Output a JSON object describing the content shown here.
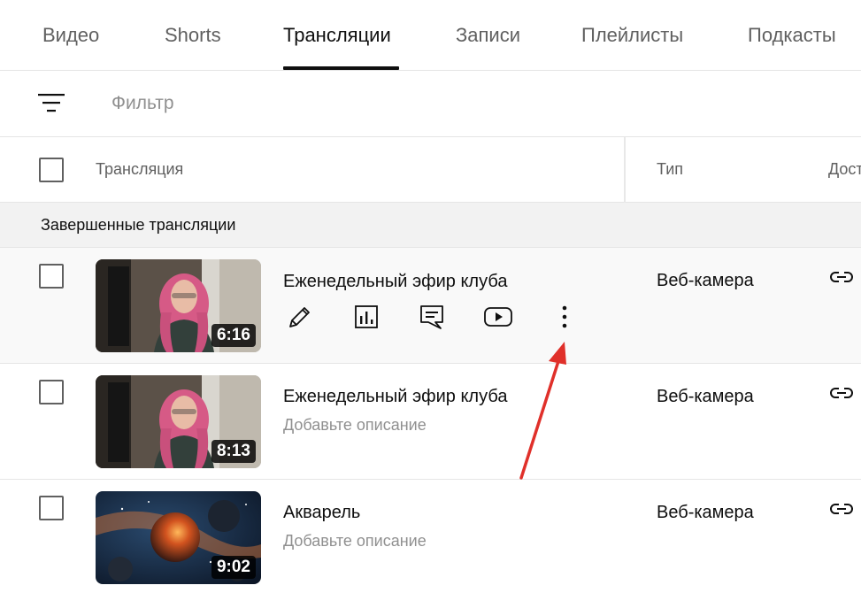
{
  "tabs": [
    {
      "label": "Видео"
    },
    {
      "label": "Shorts"
    },
    {
      "label": "Трансляции",
      "active": true
    },
    {
      "label": "Записи"
    },
    {
      "label": "Плейлисты"
    },
    {
      "label": "Подкасты"
    }
  ],
  "filter": {
    "placeholder": "Фильтр",
    "icon": "filter-icon"
  },
  "table": {
    "headers": {
      "broadcast": "Трансляция",
      "type": "Тип",
      "access": "Дост"
    },
    "section_title": "Завершенные трансляции",
    "rows": [
      {
        "title": "Еженедельный эфир клуба",
        "description": "",
        "duration": "6:16",
        "type": "Веб-камера",
        "hovered": true
      },
      {
        "title": "Еженедельный эфир клуба",
        "description": "Добавьте описание",
        "duration": "8:13",
        "type": "Веб-камера"
      },
      {
        "title": "Акварель",
        "description": "Добавьте описание",
        "duration": "9:02",
        "type": "Веб-камера"
      }
    ],
    "row_actions": [
      "pencil-icon",
      "analytics-icon",
      "comments-icon",
      "youtube-play-icon",
      "more-vert-icon"
    ]
  },
  "colors": {
    "annotation_arrow": "#e0302a",
    "text_primary": "#0f0f0f",
    "text_secondary": "#606060"
  }
}
